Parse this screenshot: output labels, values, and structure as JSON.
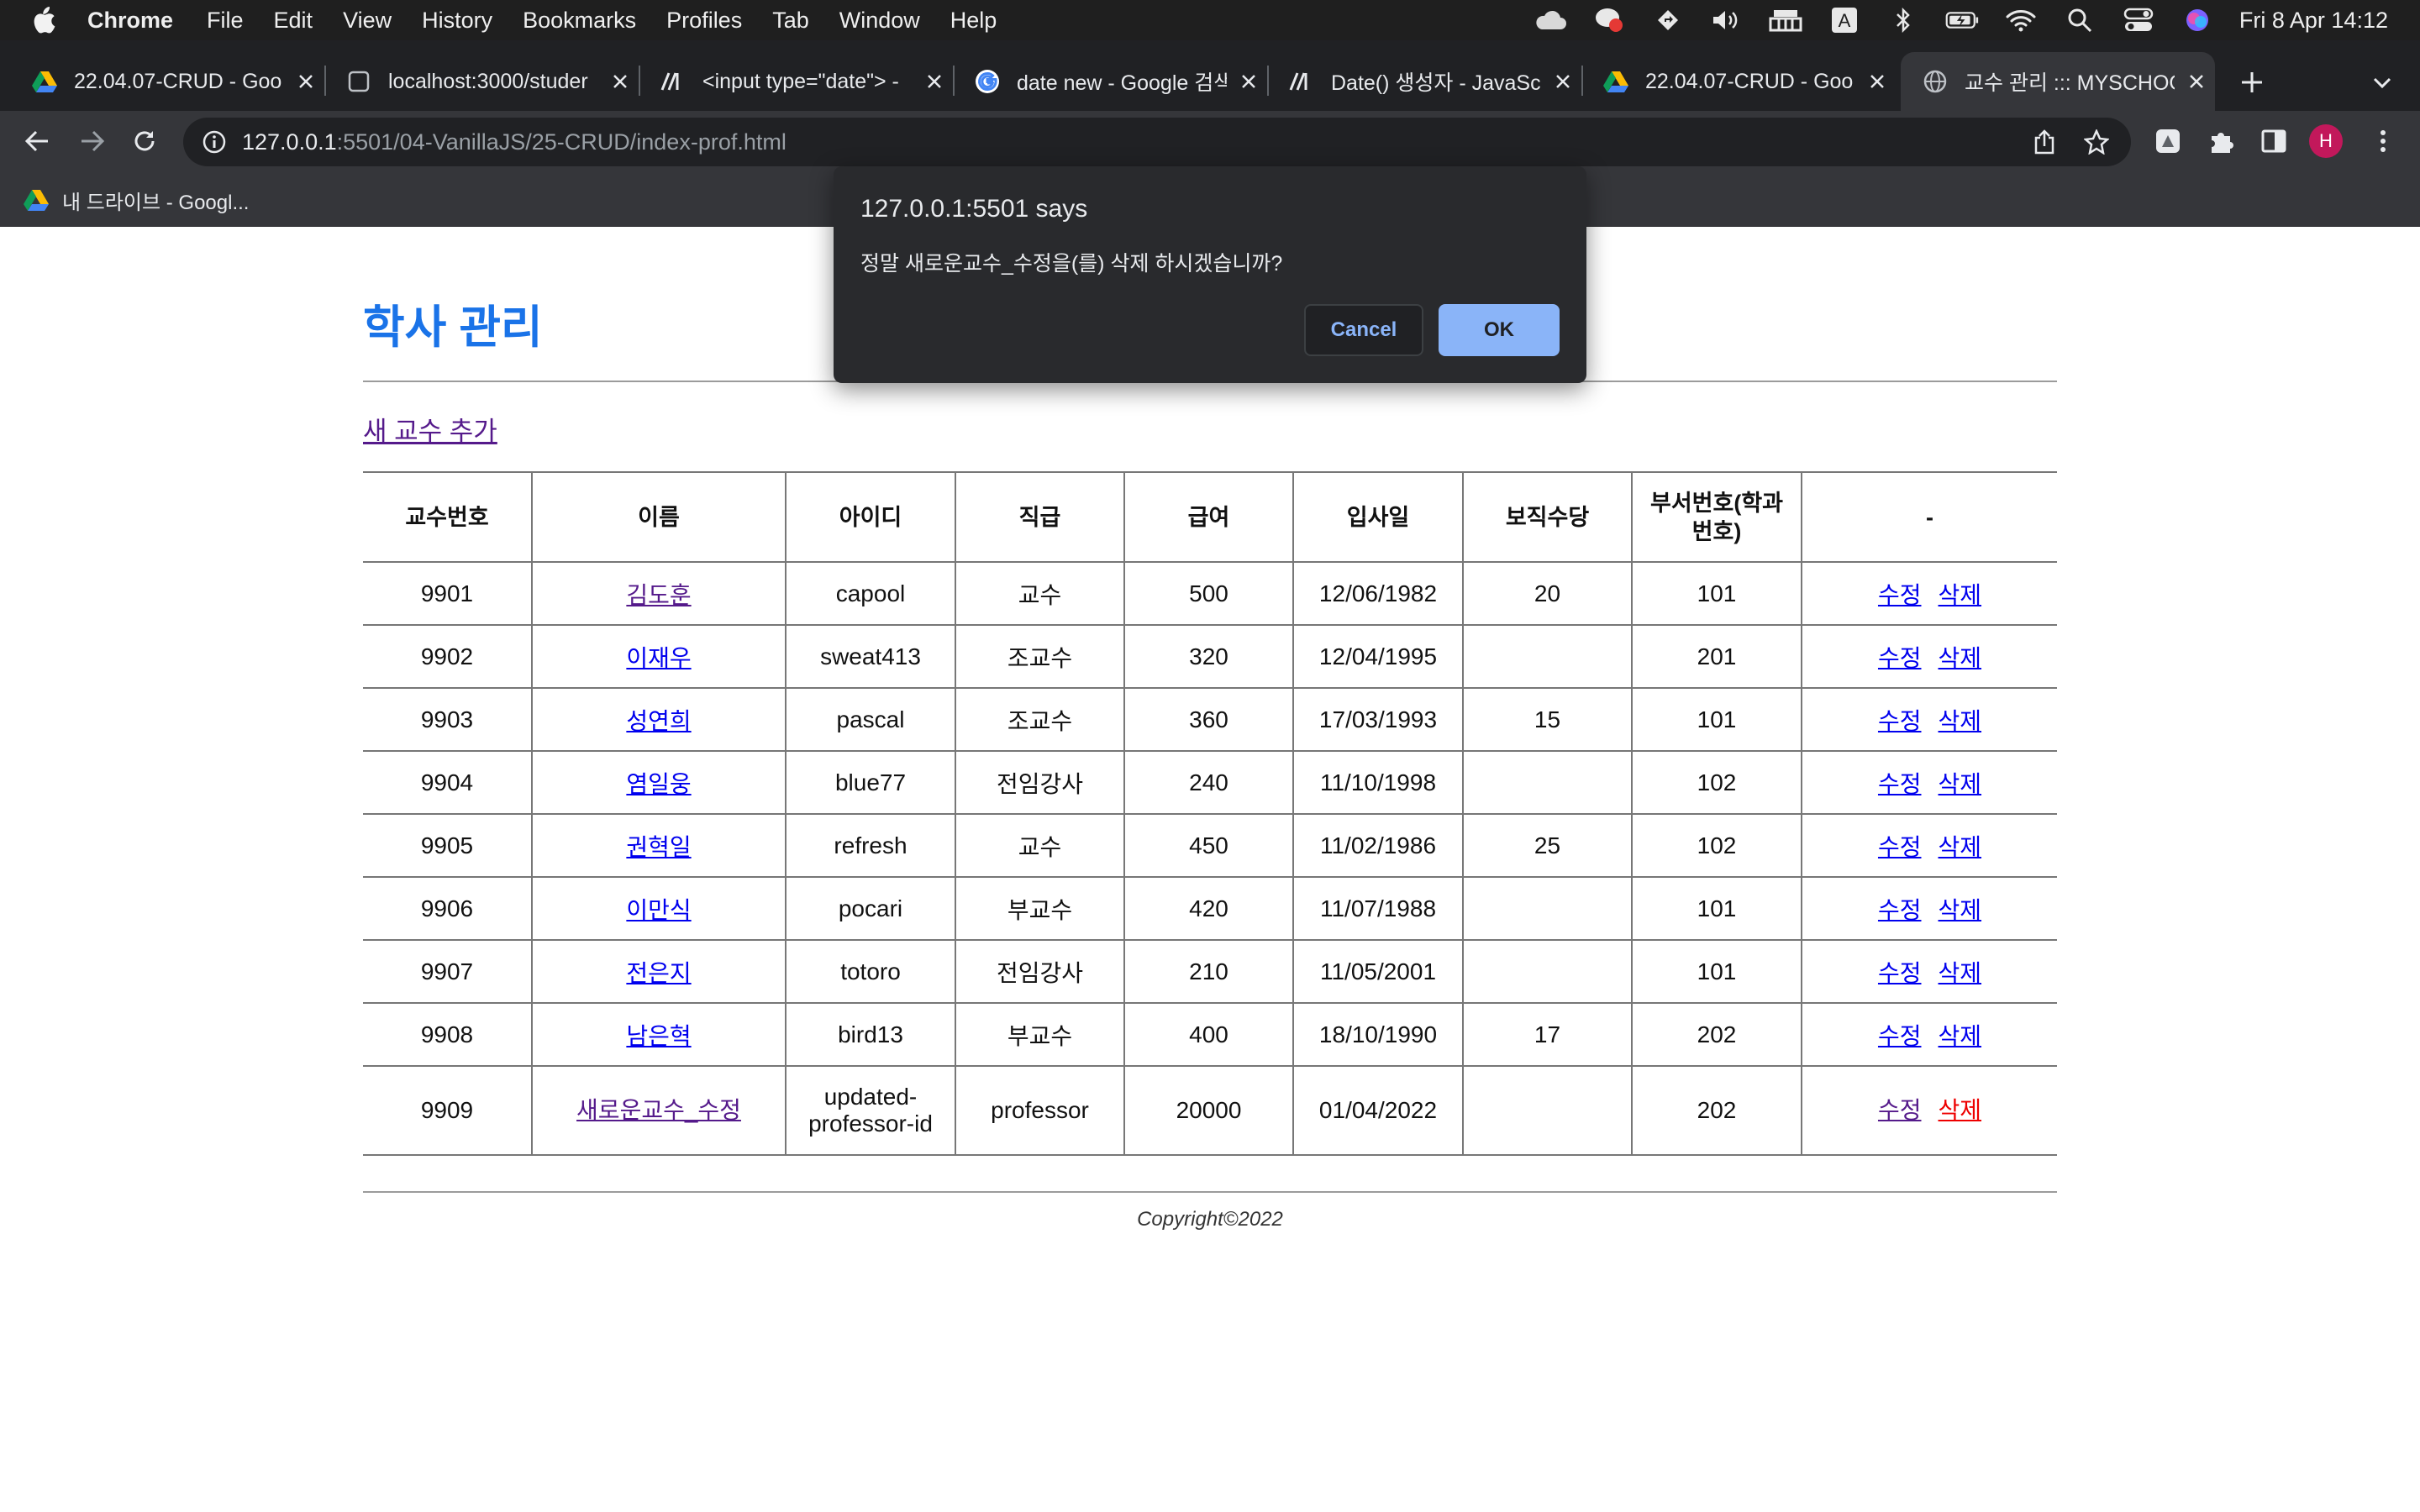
{
  "menubar": {
    "app_name": "Chrome",
    "items": [
      "File",
      "Edit",
      "View",
      "History",
      "Bookmarks",
      "Profiles",
      "Tab",
      "Window",
      "Help"
    ],
    "status_icons": [
      "cloud-icon",
      "notification-icon",
      "direction-icon",
      "volume-icon",
      "input-grid-icon",
      "keyboard-a-icon",
      "bluetooth-icon",
      "battery-icon",
      "wifi-icon",
      "spotlight-search-icon",
      "control-center-icon",
      "siri-icon"
    ],
    "keyboard_letter": "A",
    "clock": "Fri 8 Apr  14:12"
  },
  "tabs": [
    {
      "title": "22.04.07-CRUD - Goo",
      "icon": "google-drive-icon",
      "active": false
    },
    {
      "title": "localhost:3000/studer",
      "icon": "page-icon",
      "active": false
    },
    {
      "title": "<input type=\"date\"> -",
      "icon": "mdn-icon",
      "active": false
    },
    {
      "title": "date new - Google 검색",
      "icon": "google-icon",
      "active": false
    },
    {
      "title": "Date() 생성자 - JavaScr",
      "icon": "mdn-icon",
      "active": false
    },
    {
      "title": "22.04.07-CRUD - Goo",
      "icon": "google-drive-icon",
      "active": false
    },
    {
      "title": "교수 관리 ::: MYSCHOOL",
      "icon": "globe-icon",
      "active": true
    }
  ],
  "address_bar": {
    "host": "127.0.0.1",
    "path": ":5501/04-VanillaJS/25-CRUD/index-prof.html"
  },
  "profile_initial": "H",
  "bookmarks": [
    {
      "label": "내 드라이브 - Googl...",
      "icon": "google-drive-icon"
    }
  ],
  "page": {
    "title": "학사 관리",
    "add_link": "새 교수 추가",
    "table": {
      "headers": [
        "교수번호",
        "이름",
        "아이디",
        "직급",
        "급여",
        "입사일",
        "보직수당",
        "부서번호(학과\n번호)",
        "-"
      ],
      "rows": [
        {
          "no": "9901",
          "name": "김도훈",
          "id": "capool",
          "rank": "교수",
          "salary": "500",
          "hired": "12/06/1982",
          "allowance": "20",
          "dept": "101"
        },
        {
          "no": "9902",
          "name": "이재우",
          "id": "sweat413",
          "rank": "조교수",
          "salary": "320",
          "hired": "12/04/1995",
          "allowance": "",
          "dept": "201"
        },
        {
          "no": "9903",
          "name": "성연희",
          "id": "pascal",
          "rank": "조교수",
          "salary": "360",
          "hired": "17/03/1993",
          "allowance": "15",
          "dept": "101"
        },
        {
          "no": "9904",
          "name": "염일웅",
          "id": "blue77",
          "rank": "전임강사",
          "salary": "240",
          "hired": "11/10/1998",
          "allowance": "",
          "dept": "102"
        },
        {
          "no": "9905",
          "name": "권혁일",
          "id": "refresh",
          "rank": "교수",
          "salary": "450",
          "hired": "11/02/1986",
          "allowance": "25",
          "dept": "102"
        },
        {
          "no": "9906",
          "name": "이만식",
          "id": "pocari",
          "rank": "부교수",
          "salary": "420",
          "hired": "11/07/1988",
          "allowance": "",
          "dept": "101"
        },
        {
          "no": "9907",
          "name": "전은지",
          "id": "totoro",
          "rank": "전임강사",
          "salary": "210",
          "hired": "11/05/2001",
          "allowance": "",
          "dept": "101"
        },
        {
          "no": "9908",
          "name": "남은혁",
          "id": "bird13",
          "rank": "부교수",
          "salary": "400",
          "hired": "18/10/1990",
          "allowance": "17",
          "dept": "202"
        },
        {
          "no": "9909",
          "name": "새로운교수_수정",
          "id": "updated-\nprofessor-id",
          "rank": "professor",
          "salary": "20000",
          "hired": "01/04/2022",
          "allowance": "",
          "dept": "202"
        }
      ],
      "edit_label": "수정",
      "delete_label": "삭제"
    },
    "copyright": "Copyright©2022"
  },
  "dialog": {
    "title": "127.0.0.1:5501 says",
    "message": "정말 새로운교수_수정을(를) 삭제 하시겠습니까?",
    "cancel_label": "Cancel",
    "ok_label": "OK"
  },
  "colors": {
    "page_title": "#1a73e8",
    "link": "#0000ee",
    "visited_link": "#551a8b",
    "active_link": "#ee0000",
    "dialog_ok": "#8ab4f8"
  }
}
